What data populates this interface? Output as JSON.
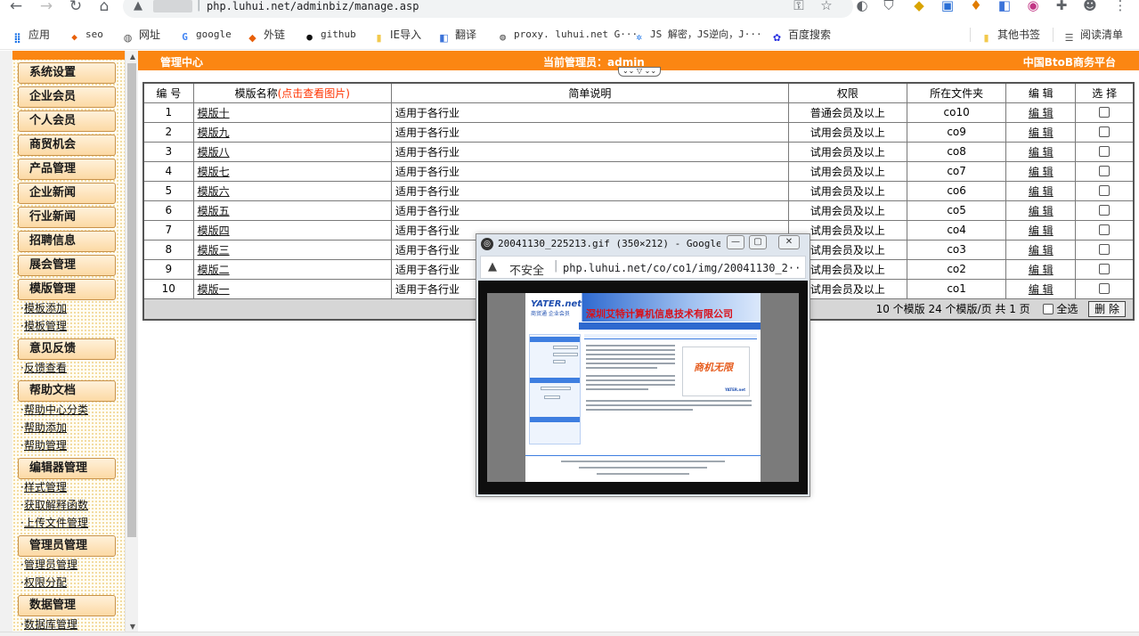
{
  "browser": {
    "url": "php.luhui.net/adminbiz/manage.asp",
    "bookmarks": [
      {
        "label": "应用",
        "icon": "apps-grid-icon"
      },
      {
        "label": "seo",
        "icon": "bookmark-favicon"
      },
      {
        "label": "网址",
        "icon": "globe-icon"
      },
      {
        "label": "google",
        "icon": "google-icon"
      },
      {
        "label": "外链",
        "icon": "bookmark-favicon"
      },
      {
        "label": "github",
        "icon": "github-icon"
      },
      {
        "label": "IE导入",
        "icon": "folder-icon"
      },
      {
        "label": "翻译",
        "icon": "translate-icon"
      },
      {
        "label": "proxy. luhui.net G···",
        "icon": "globe-icon"
      },
      {
        "label": "JS 解密，JS逆向，J···",
        "icon": "gear-icon"
      },
      {
        "label": "百度搜索",
        "icon": "baidu-icon"
      },
      {
        "label": "其他书签",
        "icon": "folder-icon"
      },
      {
        "label": "阅读清单",
        "icon": "reading-list-icon"
      }
    ]
  },
  "sidebar": {
    "sections": [
      {
        "label": "系统设置",
        "subs": []
      },
      {
        "label": "企业会员",
        "subs": []
      },
      {
        "label": "个人会员",
        "subs": []
      },
      {
        "label": "商贸机会",
        "subs": []
      },
      {
        "label": "产品管理",
        "subs": []
      },
      {
        "label": "企业新闻",
        "subs": []
      },
      {
        "label": "行业新闻",
        "subs": []
      },
      {
        "label": "招聘信息",
        "subs": []
      },
      {
        "label": "展会管理",
        "subs": []
      },
      {
        "label": "模版管理",
        "subs": [
          "模板添加",
          "模板管理"
        ]
      },
      {
        "label": "意见反馈",
        "subs": [
          "反馈查看"
        ]
      },
      {
        "label": "帮助文档",
        "subs": [
          "帮助中心分类",
          "帮助添加",
          "帮助管理"
        ]
      },
      {
        "label": "编辑器管理",
        "subs": [
          "样式管理",
          "获取解释函数",
          "上传文件管理"
        ]
      },
      {
        "label": "管理员管理",
        "subs": [
          "管理员管理",
          "权限分配"
        ]
      },
      {
        "label": "数据管理",
        "subs": [
          "数据库管理"
        ]
      }
    ]
  },
  "header": {
    "title": "管理中心",
    "admin_label": "当前管理员：admin",
    "site_name": "中国BtoB商务平台",
    "collapse_glyph": "⌄⌄ ▽ ⌄⌄"
  },
  "table": {
    "headers": {
      "no": "编 号",
      "name_prefix": "模版名称",
      "name_hint": "(点击查看图片)",
      "desc": "简单说明",
      "perm": "权限",
      "folder": "所在文件夹",
      "edit": "编 辑",
      "select": "选 择"
    },
    "rows": [
      {
        "no": "1",
        "name": "模版十",
        "desc": "适用于各行业",
        "perm": "普通会员及以上",
        "folder": "co10",
        "edit": "编 辑"
      },
      {
        "no": "2",
        "name": "模版九",
        "desc": "适用于各行业",
        "perm": "试用会员及以上",
        "folder": "co9",
        "edit": "编 辑"
      },
      {
        "no": "3",
        "name": "模版八",
        "desc": "适用于各行业",
        "perm": "试用会员及以上",
        "folder": "co8",
        "edit": "编 辑"
      },
      {
        "no": "4",
        "name": "模版七",
        "desc": "适用于各行业",
        "perm": "试用会员及以上",
        "folder": "co7",
        "edit": "编 辑"
      },
      {
        "no": "5",
        "name": "模版六",
        "desc": "适用于各行业",
        "perm": "试用会员及以上",
        "folder": "co6",
        "edit": "编 辑"
      },
      {
        "no": "6",
        "name": "模版五",
        "desc": "适用于各行业",
        "perm": "试用会员及以上",
        "folder": "co5",
        "edit": "编 辑"
      },
      {
        "no": "7",
        "name": "模版四",
        "desc": "适用于各行业",
        "perm": "试用会员及以上",
        "folder": "co4",
        "edit": "编 辑"
      },
      {
        "no": "8",
        "name": "模版三",
        "desc": "适用于各行业",
        "perm": "试用会员及以上",
        "folder": "co3",
        "edit": "编 辑"
      },
      {
        "no": "9",
        "name": "模版二",
        "desc": "适用于各行业",
        "perm": "试用会员及以上",
        "folder": "co2",
        "edit": "编 辑"
      },
      {
        "no": "10",
        "name": "模版一",
        "desc": "适用于各行业",
        "perm": "试用会员及以上",
        "folder": "co1",
        "edit": "编 辑"
      }
    ],
    "footer": {
      "summary": "10 个模版  24 个模版/页  共 1 页",
      "select_all": "全选",
      "delete": "删 除"
    }
  },
  "popup": {
    "title": "20041130_225213.gif (350×212) - Google···",
    "insecure_label": "不安全",
    "url": "php.luhui.net/co/co1/img/20041130_2···",
    "preview": {
      "logo": "YATER.net",
      "logo_sub": "商贸通 企业会员",
      "company": "深圳艾特计算机信息技术有限公司",
      "ad_text": "商机无限",
      "ad_brand": "YATER.net"
    }
  },
  "colors": {
    "accent_orange": "#fb8612",
    "hint_red": "#ff3300",
    "sidebar_button": "#fcd9a4"
  }
}
